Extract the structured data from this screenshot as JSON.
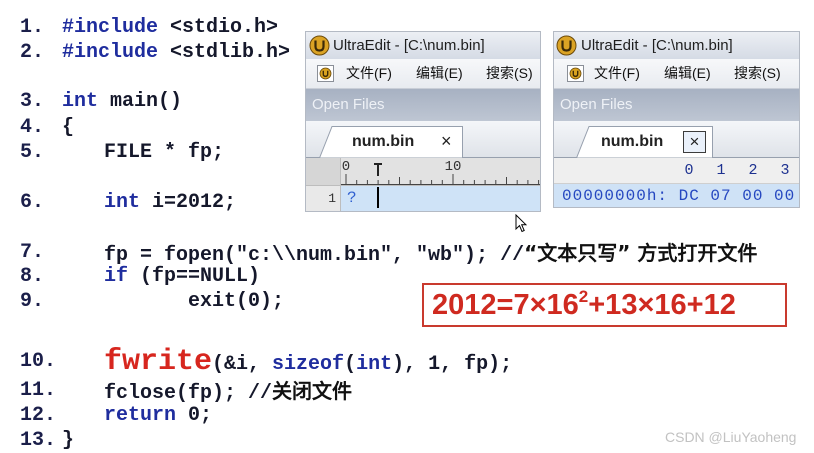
{
  "colors": {
    "keyword": "#1f2d9e",
    "code": "#15182b",
    "line_number": "#1b1f4a",
    "fwrite": "#d7261e",
    "formula": "#cf2a20",
    "hex_text": "#2547c0"
  },
  "icons": {
    "title_bar": "ultraedit-icon",
    "menu_bar": "ultraedit-document-icon",
    "tab_close": "close-icon",
    "pointer": "mouse-pointer-icon"
  },
  "code": {
    "lines": [
      {
        "num": "1.",
        "parts": [
          "#include",
          " <stdio.h>"
        ]
      },
      {
        "num": "2.",
        "parts": [
          "#include",
          " <stdlib.h>"
        ]
      },
      {
        "num": "3.",
        "parts": [
          "int",
          " main()"
        ]
      },
      {
        "num": "4.",
        "parts": [
          "{"
        ]
      },
      {
        "num": "5.",
        "parts": [
          "FILE * fp;"
        ]
      },
      {
        "num": "6.",
        "parts": [
          "int",
          " i=2012;"
        ]
      },
      {
        "num": "7.",
        "parts": [
          "fp = fopen(\"c:\\\\num.bin\", \"wb\"); //",
          "“文本只写” 方式打开文件"
        ]
      },
      {
        "num": "8.",
        "parts": [
          "if",
          " (fp==NULL)"
        ]
      },
      {
        "num": "9.",
        "parts": [
          "exit(0);"
        ]
      },
      {
        "num": "10.",
        "parts": [
          "fwrite",
          "(&i, ",
          "sizeof",
          "(",
          "int",
          "), 1, fp);"
        ]
      },
      {
        "num": "11.",
        "parts": [
          "fclose(fp); //",
          "关闭文件"
        ]
      },
      {
        "num": "12.",
        "parts": [
          "return",
          " 0;"
        ]
      },
      {
        "num": "13.",
        "parts": [
          "}"
        ]
      }
    ]
  },
  "windows": [
    {
      "title": "UltraEdit - [C:\\num.bin]",
      "menu": [
        "文件(F)",
        "编辑(E)",
        "搜索(S)"
      ],
      "panel_title": "Open Files",
      "tab": "num.bin",
      "close": "×",
      "ruler": [
        "0",
        "10"
      ],
      "line_number": "1",
      "content": "?"
    },
    {
      "title": "UltraEdit - [C:\\num.bin]",
      "menu": [
        "文件(F)",
        "编辑(E)",
        "搜索(S)"
      ],
      "panel_title": "Open Files",
      "tab": "num.bin",
      "close": "×",
      "hex_header": [
        "0",
        "1",
        "2",
        "3"
      ],
      "content": "00000000h: DC 07 00 00"
    }
  ],
  "formula": {
    "base": "2012=7×16",
    "sup": "2",
    "rest": "+13×16+12"
  },
  "watermark": "CSDN @LiuYaoheng"
}
